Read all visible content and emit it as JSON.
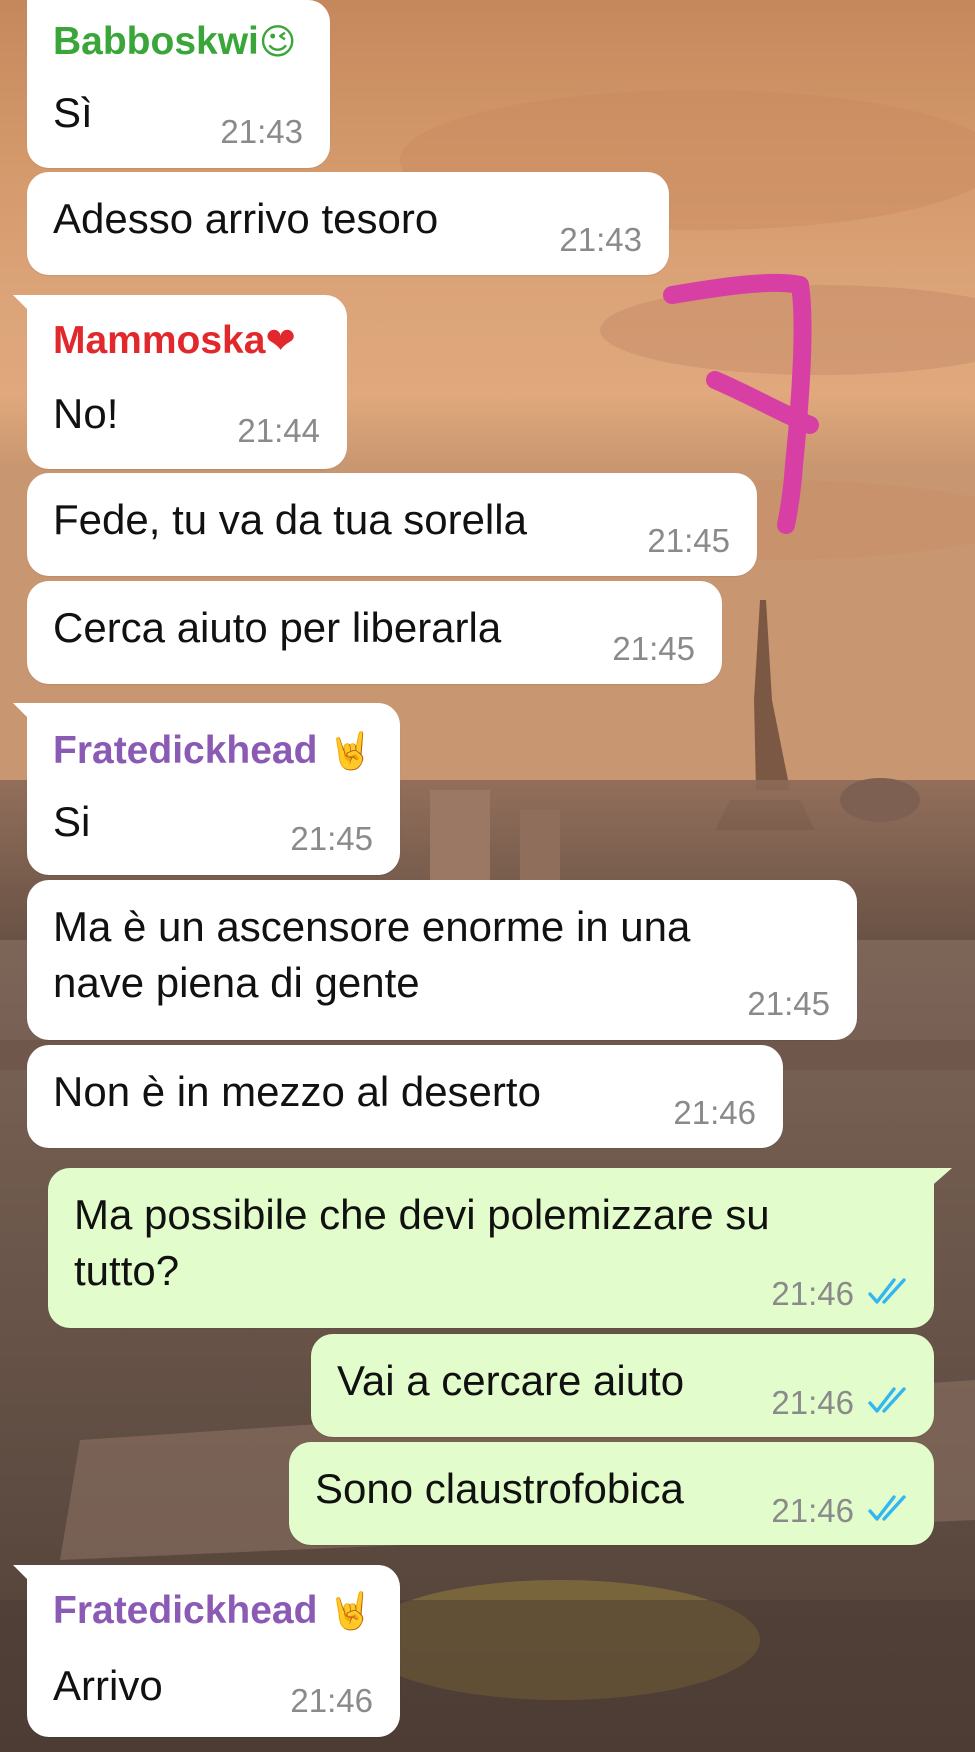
{
  "colors": {
    "babbo": "#3aa63a",
    "mammoska": "#e0282d",
    "frate": "#8a5ab5",
    "incoming_bg": "#ffffff",
    "outgoing_bg": "#e2fdcb",
    "read_ticks": "#34b7f1",
    "drawing": "#d83fa4"
  },
  "annotation": {
    "type": "handwritten-mark",
    "label": "7"
  },
  "messages": [
    {
      "sender": "Babboskwi",
      "sender_emoji": "😉",
      "text": "Sì",
      "time": "21:43",
      "direction": "in"
    },
    {
      "text": "Adesso arrivo tesoro",
      "time": "21:43",
      "direction": "in"
    },
    {
      "sender": "Mammoska",
      "sender_emoji": "❤️",
      "text": "No!",
      "time": "21:44",
      "direction": "in"
    },
    {
      "text": "Fede, tu va da tua sorella",
      "time": "21:45",
      "direction": "in"
    },
    {
      "text": "Cerca aiuto per liberarla",
      "time": "21:45",
      "direction": "in"
    },
    {
      "sender": "Fratedickhead",
      "sender_emoji": "🤘",
      "text": "Si",
      "time": "21:45",
      "direction": "in"
    },
    {
      "text_lines": [
        "Ma è un ascensore enorme in una",
        "nave piena di gente"
      ],
      "time": "21:45",
      "direction": "in"
    },
    {
      "text": "Non è in mezzo al deserto",
      "time": "21:46",
      "direction": "in"
    },
    {
      "text_lines": [
        "Ma possibile che devi polemizzare su",
        "tutto?"
      ],
      "time": "21:46",
      "direction": "out",
      "status": "read"
    },
    {
      "text": "Vai a cercare aiuto",
      "time": "21:46",
      "direction": "out",
      "status": "read"
    },
    {
      "text": "Sono claustrofobica",
      "time": "21:46",
      "direction": "out",
      "status": "read"
    },
    {
      "sender": "Fratedickhead",
      "sender_emoji": "🤘",
      "text": "Arrivo",
      "time": "21:46",
      "direction": "in"
    }
  ]
}
